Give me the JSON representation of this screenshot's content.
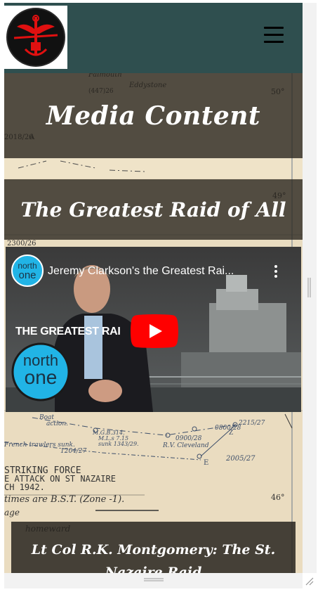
{
  "navbar": {
    "logo_alt": "Combined Operations emblem",
    "menu_icon": "hamburger-menu-icon",
    "background": "#2f4f4f"
  },
  "hero": {
    "title": "Media Content"
  },
  "section": {
    "title": "The Greatest Raid of All"
  },
  "video": {
    "channel_logo_top": "north",
    "channel_logo_bottom": "one",
    "title": "Jeremy Clarkson's the Greatest Rai...",
    "overlay_text": "THE GREATEST RAI        L",
    "big_logo_top": "north",
    "big_logo_bottom": "one",
    "play_color": "#ff0000"
  },
  "map_labels": {
    "top": [
      "Falmouth",
      "(447)26",
      "Eddystone",
      "50°",
      "2018/26",
      "A",
      "49°",
      "2300/26"
    ],
    "bottom": [
      "Boat action.",
      "M.G.B.314.",
      "M.L.s 7.15",
      "sunk 1343/29.",
      "0800/28",
      "2215/27",
      "Z",
      "French trawlers sunk.",
      "1204/27",
      "0900/28",
      "R.V. Cleveland",
      "2005/27",
      "E",
      "STRIKING FORCE",
      "E ATTACK ON ST NAZAIRE",
      "CH 1942.",
      "times are B.S.T. (Zone -1).",
      "46°",
      "age",
      "homeward"
    ]
  },
  "card": {
    "title": "Lt Col R.K. Montgomery: The St. Nazaire Raid"
  }
}
